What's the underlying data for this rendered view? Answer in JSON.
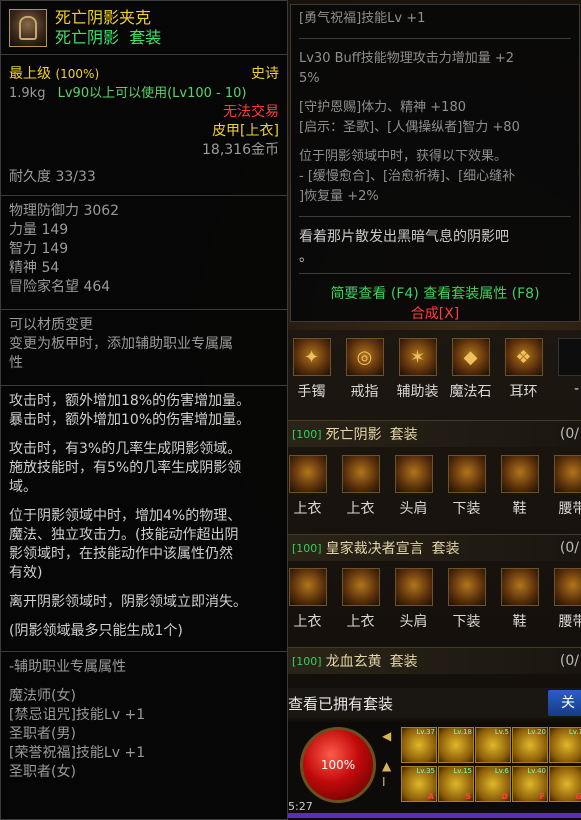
{
  "item": {
    "name": "死亡阴影夹克",
    "set_name": "死亡阴影",
    "set_tag": "套装",
    "grade": "最上级",
    "grade_pct": "(100%)",
    "rarity": "史诗",
    "weight": "1.9kg",
    "level_req": "Lv90以上可以使用(Lv100 - 10)",
    "trade": "无法交易",
    "type": "皮甲[上衣]",
    "price": "18,316金币",
    "durability": "耐久度 33/33",
    "stats": [
      "物理防御力 3062",
      "力量 149",
      "智力 149",
      "精神 54",
      "冒险家名望 464"
    ],
    "material": [
      "可以材质变更",
      "变更为板甲时，添加辅助职业专属属",
      "性"
    ],
    "effects1": [
      "攻击时，额外增加18%的伤害增加量。",
      "暴击时，额外增加10%的伤害增加量。"
    ],
    "effects2": [
      "攻击时，有3%的几率生成阴影领域。",
      "施放技能时，有5%的几率生成阴影领",
      "域。"
    ],
    "effects3": [
      "位于阴影领域中时，增加4%的物理、",
      "魔法、独立攻击力。(技能动作超出阴",
      "影领域时，在技能动作中该属性仍然",
      "有效)"
    ],
    "effects4": [
      "离开阴影领域时，阴影领域立即消失。"
    ],
    "effects5": [
      "(阴影领域最多只能生成1个)"
    ],
    "support_title": "-辅助职业专属属性",
    "support_lines": [
      "魔法师(女)",
      "[禁忌诅咒]技能Lv +1",
      "圣职者(男)",
      "[荣誉祝福]技能Lv +1",
      "圣职者(女)"
    ]
  },
  "right_tip": {
    "line1": "[勇气祝福]技能Lv +1",
    "buff": [
      "Lv30 Buff技能物理攻击力增加量 +2",
      "5%"
    ],
    "guard": [
      "[守护恩赐]体力、精神 +180",
      "[启示：圣歌]、[人偶操纵者]智力 +80"
    ],
    "domain": [
      "位于阴影领域中时，获得以下效果。",
      "- [缓慢愈合]、[治愈祈祷]、[细心缝补",
      "]恢复量 +2%"
    ],
    "flavor": [
      "看着那片散发出黑暗气息的阴影吧",
      "。"
    ],
    "hint": "简要查看 (F4) 查看套装属性 (F8)",
    "compose": "合成[X]"
  },
  "equip_row": [
    "手镯",
    "戒指",
    "辅助装",
    "魔法石",
    "耳环",
    "-"
  ],
  "sets": [
    {
      "count": "[100]",
      "name": "死亡阴影",
      "tag": "套装",
      "frac": "(0/"
    },
    {
      "count": "[100]",
      "name": "皇家裁决者宣言",
      "tag": "套装",
      "frac": "(0/"
    },
    {
      "count": "[100]",
      "name": "龙血玄黄",
      "tag": "套装",
      "frac": "(0/"
    }
  ],
  "set_slots": [
    "上衣",
    "上衣",
    "头肩",
    "下装",
    "鞋",
    "腰带"
  ],
  "view_owned": "查看已拥有套装",
  "close_label": "关",
  "hud": {
    "hp": "100%",
    "clock": "5:27",
    "skills_top": [
      {
        "lv": "Lv.37",
        "key": ""
      },
      {
        "lv": "Lv.18",
        "key": ""
      },
      {
        "lv": "Lv.5",
        "key": ""
      },
      {
        "lv": "Lv.20",
        "key": ""
      },
      {
        "lv": "Lv.1",
        "key": ""
      }
    ],
    "skills_bottom": [
      {
        "lv": "Lv.35",
        "key": "A"
      },
      {
        "lv": "Lv.15",
        "key": "S"
      },
      {
        "lv": "Lv.6",
        "key": "D"
      },
      {
        "lv": "Lv.40",
        "key": "F"
      },
      {
        "lv": "",
        "key": "G"
      }
    ]
  },
  "colors": {
    "name_yellow": "#f2d02a",
    "set_green": "#3ee26a",
    "warn_red": "#ff3b3b",
    "hint_green": "#3fd05a"
  }
}
